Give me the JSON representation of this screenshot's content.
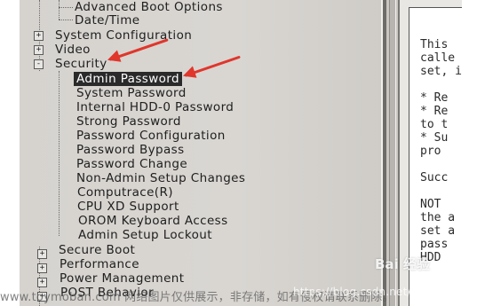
{
  "tree": {
    "advanced_boot_options": "Advanced Boot Options",
    "date_time": "Date/Time",
    "system_configuration": "System Configuration",
    "video": "Video",
    "security": "Security",
    "security_items": [
      "Admin Password",
      "System Password",
      "Internal HDD-0 Password",
      "Strong Password",
      "Password Configuration",
      "Password Bypass",
      "Password Change",
      "Non-Admin Setup Changes",
      "Computrace(R)",
      "CPU XD Support",
      "OROM Keyboard Access",
      "Admin Setup Lockout"
    ],
    "secure_boot": "Secure Boot",
    "performance": "Performance",
    "power_management": "Power Management",
    "post_behavior": "POST Behavior",
    "expand_plus": "+",
    "collapse_minus": "-"
  },
  "help_panel": {
    "lines": [
      "This",
      "calle",
      "set, i",
      "",
      "* Re",
      "* Re",
      "  to t",
      "* Su",
      "  pro",
      "",
      "Succ",
      "",
      "NOT",
      "the a",
      "set a",
      "pass",
      "HDD"
    ]
  },
  "watermark": {
    "text": "www.toymoban.com 网络图片仅供展示，非存储，如有侵权请联系删除。",
    "url_overlay": "https://blog.csdn.net/qq_40807977",
    "baidu": "Bai 经验"
  },
  "colors": {
    "arrow": "#e0362c",
    "selection_bg": "#2a2a2a",
    "panel_bg": "#d6d3cf"
  }
}
